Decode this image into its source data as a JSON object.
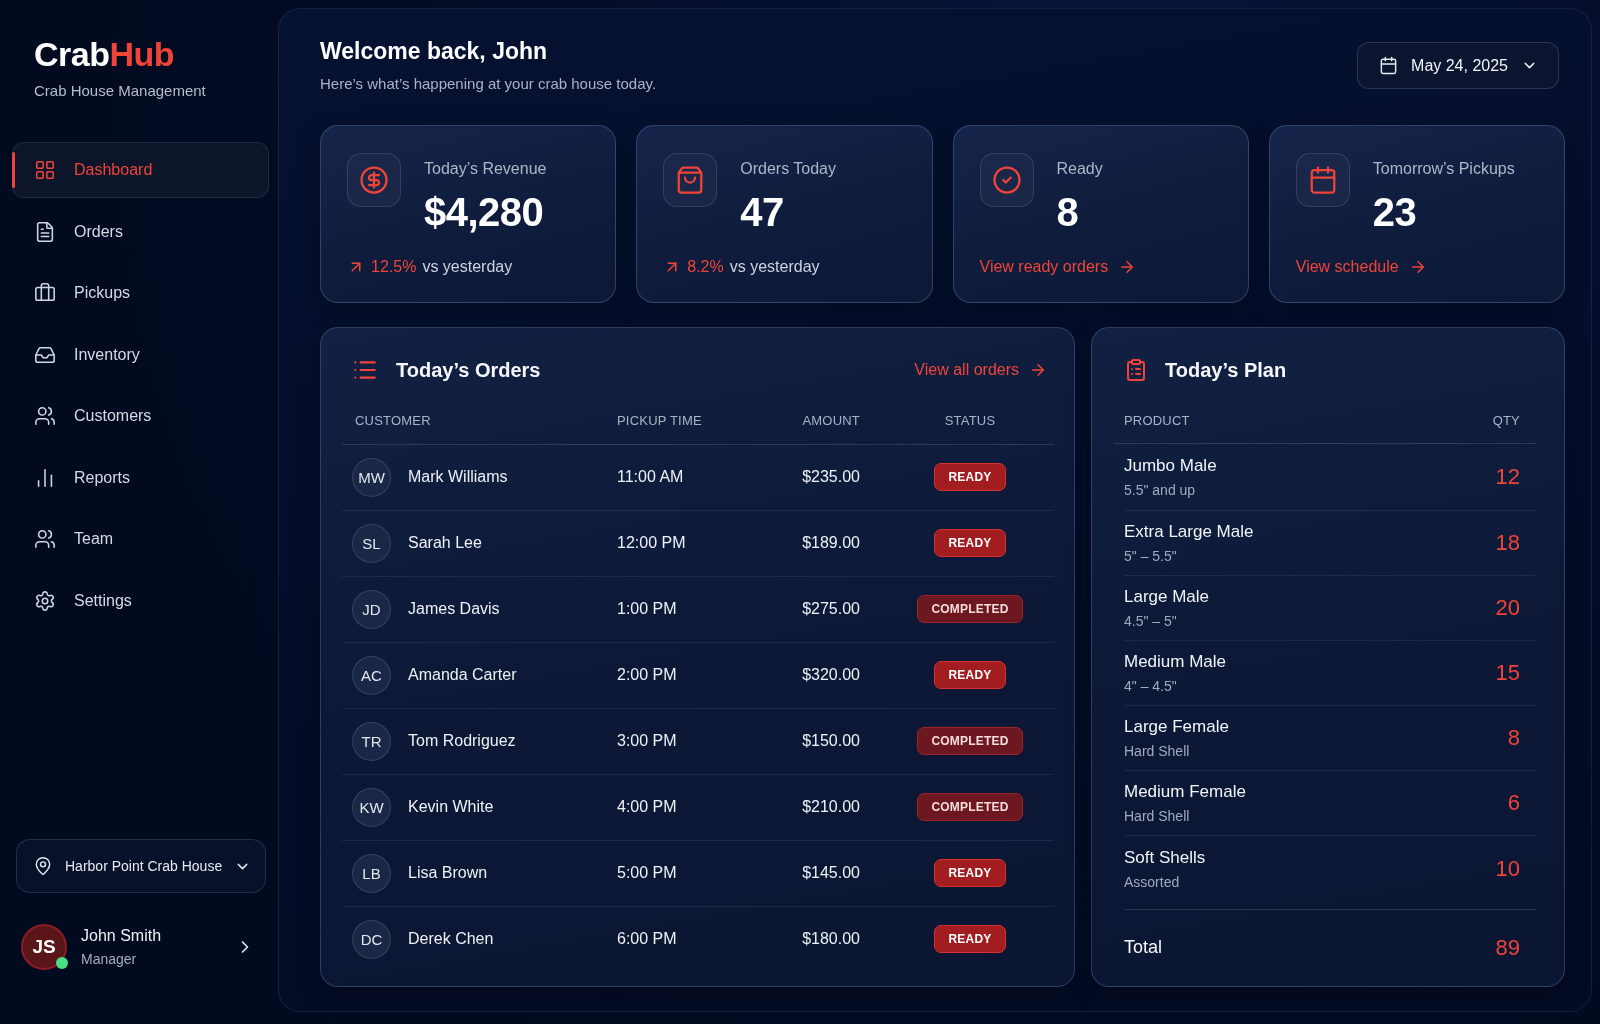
{
  "sidebar": {
    "logo": {
      "text": "Crab",
      "accent": "Hub"
    },
    "tagline": "Crab House Management",
    "nav": [
      {
        "label": "Dashboard",
        "selected": true
      },
      {
        "label": "Orders",
        "selected": false
      },
      {
        "label": "Pickups",
        "selected": false
      },
      {
        "label": "Inventory",
        "selected": false
      },
      {
        "label": "Customers",
        "selected": false
      },
      {
        "label": "Reports",
        "selected": false
      },
      {
        "label": "Team",
        "selected": false
      },
      {
        "label": "Settings",
        "selected": false
      }
    ],
    "location": {
      "value": "Harbor Point Crab House"
    },
    "user": {
      "initials": "JS",
      "name": "John Smith",
      "role": "Manager",
      "online": true
    }
  },
  "header": {
    "title": "Welcome back, John",
    "subtitle": "Here’s what’s happening at your crab house today.",
    "date": "May 24, 2025"
  },
  "stats": [
    {
      "kind": "trend",
      "label": "Today’s Revenue",
      "value": "$4,280",
      "change": "12.5%",
      "comparison": "vs yesterday"
    },
    {
      "kind": "trend",
      "label": "Orders Today",
      "value": "47",
      "change": "8.2%",
      "comparison": "vs yesterday"
    },
    {
      "kind": "link",
      "label": "Ready",
      "value": "8",
      "link": "View ready orders"
    },
    {
      "kind": "link",
      "label": "Tomorrow’s Pickups",
      "value": "23",
      "link": "View schedule"
    }
  ],
  "orders": {
    "title": "Today’s Orders",
    "link": "View all orders",
    "columns": [
      "CUSTOMER",
      "PICKUP TIME",
      "AMOUNT",
      "STATUS"
    ],
    "rows": [
      {
        "initials": "MW",
        "customer": "Mark Williams",
        "pickup_time": "11:00 AM",
        "amount": "$235.00",
        "status": {
          "kind": "ready",
          "label": "READY"
        }
      },
      {
        "initials": "SL",
        "customer": "Sarah Lee",
        "pickup_time": "12:00 PM",
        "amount": "$189.00",
        "status": {
          "kind": "ready",
          "label": "READY"
        }
      },
      {
        "initials": "JD",
        "customer": "James Davis",
        "pickup_time": "1:00 PM",
        "amount": "$275.00",
        "status": {
          "kind": "completed",
          "label": "COMPLETED"
        }
      },
      {
        "initials": "AC",
        "customer": "Amanda Carter",
        "pickup_time": "2:00 PM",
        "amount": "$320.00",
        "status": {
          "kind": "ready",
          "label": "READY"
        }
      },
      {
        "initials": "TR",
        "customer": "Tom Rodriguez",
        "pickup_time": "3:00 PM",
        "amount": "$150.00",
        "status": {
          "kind": "completed",
          "label": "COMPLETED"
        }
      },
      {
        "initials": "KW",
        "customer": "Kevin White",
        "pickup_time": "4:00 PM",
        "amount": "$210.00",
        "status": {
          "kind": "completed",
          "label": "COMPLETED"
        }
      },
      {
        "initials": "LB",
        "customer": "Lisa Brown",
        "pickup_time": "5:00 PM",
        "amount": "$145.00",
        "status": {
          "kind": "ready",
          "label": "READY"
        }
      },
      {
        "initials": "DC",
        "customer": "Derek Chen",
        "pickup_time": "6:00 PM",
        "amount": "$180.00",
        "status": {
          "kind": "ready",
          "label": "READY"
        }
      }
    ]
  },
  "plan": {
    "title": "Today’s Plan",
    "columns": [
      "PRODUCT",
      "QTY"
    ],
    "rows": [
      {
        "product": "Jumbo Male",
        "detail": "5.5\" and up",
        "qty": "12"
      },
      {
        "product": "Extra Large Male",
        "detail": "5\" – 5.5\"",
        "qty": "18"
      },
      {
        "product": "Large Male",
        "detail": "4.5\" – 5\"",
        "qty": "20"
      },
      {
        "product": "Medium Male",
        "detail": "4\" – 4.5\"",
        "qty": "15"
      },
      {
        "product": "Large Female",
        "detail": "Hard Shell",
        "qty": "8"
      },
      {
        "product": "Medium Female",
        "detail": "Hard Shell",
        "qty": "6"
      },
      {
        "product": "Soft Shells",
        "detail": "Assorted",
        "qty": "10"
      }
    ],
    "total": {
      "label": "Total",
      "qty": "89"
    }
  }
}
